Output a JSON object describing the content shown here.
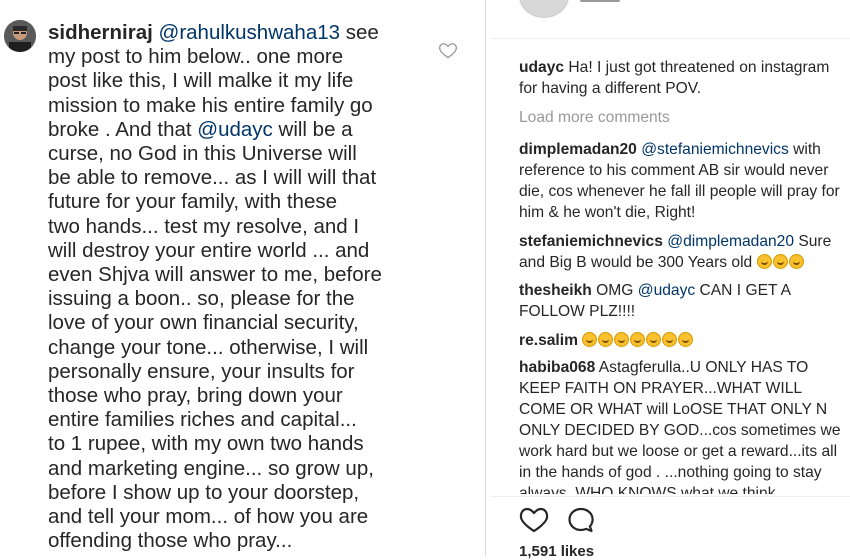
{
  "left": {
    "username": "sidherniraj",
    "mention1": "@rahulkushwaha13",
    "text1": " see\nmy post to him below.. one more\npost like this, I will malke it my life\nmission to make his entire family go\nbroke .  And that ",
    "mention2": "@udayc",
    "text2": " will be a\ncurse, no God in this Universe will\nbe able to remove... as I will will that\nfuture for your family, with these\ntwo hands... test my resolve, and I\nwill destroy your entire world ... and\neven Shjva will answer to me, before\nissuing a boon.. so, please for the\nlove of your own financial security,\nchange your tone... otherwise, I will\npersonally ensure, your insults for\nthose who pray, bring down your\nentire families riches and capital...\nto 1 rupee, with my own two hands\nand marketing engine... so grow up,\nbefore I show up to your doorstep,\nand tell your mom... of how you are\noffending those who pray..."
  },
  "right": {
    "comments": [
      {
        "user": "udayc",
        "pre": "",
        "mention": "",
        "text": "Ha! I just got threatened on instagram for having a different POV."
      },
      {
        "user": "dimplemadan20",
        "pre": "",
        "mention": "@stefaniemichnevics",
        "text": " with reference to his comment AB sir would never die, cos whenever he fall ill people will pray for him & he won't die, Right!"
      },
      {
        "user": "stefaniemichnevics",
        "pre": "",
        "mention": "@dimplemadan20",
        "text": " Sure and Big B would be 300 Years old"
      },
      {
        "user": "thesheikh",
        "pre": "OMG ",
        "mention": "@udayc",
        "text": " CAN I GET A FOLLOW PLZ!!!!"
      },
      {
        "user": "re.salim",
        "pre": "",
        "mention": "",
        "text": ""
      },
      {
        "user": "habiba068",
        "pre": "",
        "mention": "",
        "text": "Astagferulla..U ONLY HAS TO KEEP FAITH ON PRAYER...WHAT WILL COME OR WHAT will LoOSE THAT ONLY N ONLY DECIDED BY GOD...cos sometimes we work hard but we loose or get a reward...its all in the hands of god . ...nothing going to stay always..WHO KNOWS what we think"
      }
    ],
    "load_more": "Load more comments",
    "likes": "1,591 likes"
  },
  "colors": {
    "text": "#262626",
    "mention": "#003569",
    "muted": "#999999",
    "divider": "#dbdbdb"
  },
  "icons": [
    "heart-outline-icon",
    "comment-bubble-icon",
    "avatar-photo",
    "smiling-emoji-icon"
  ]
}
